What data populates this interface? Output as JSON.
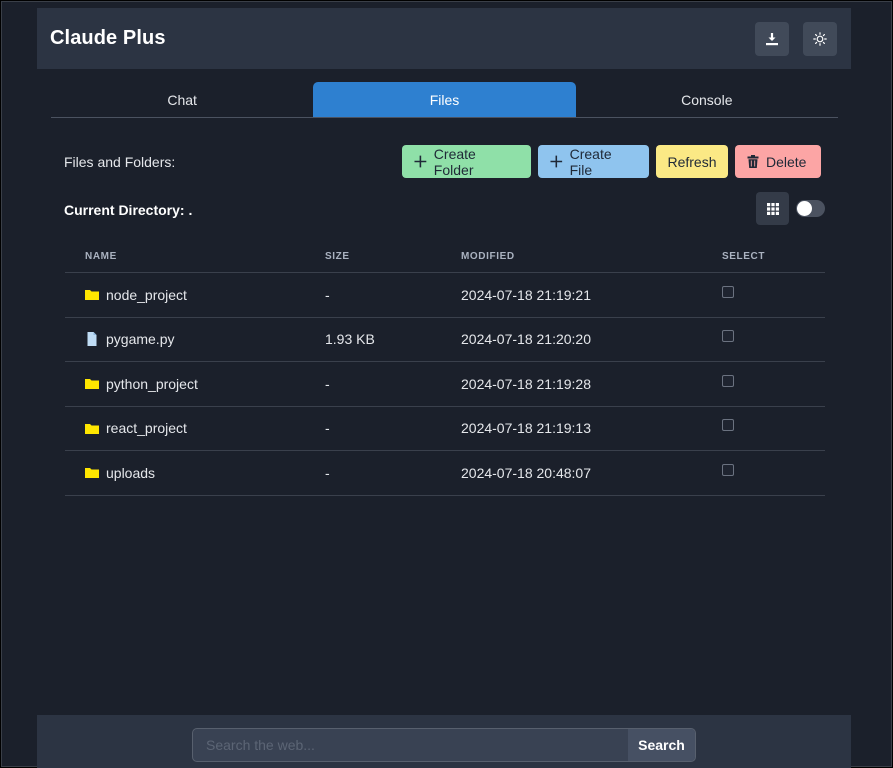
{
  "header": {
    "title": "Claude Plus",
    "download_icon": "download-icon",
    "theme_icon": "sun-icon"
  },
  "tabs": [
    {
      "label": "Chat",
      "active": false
    },
    {
      "label": "Files",
      "active": true
    },
    {
      "label": "Console",
      "active": false
    }
  ],
  "files": {
    "section_label": "Files and Folders:",
    "buttons": {
      "create_folder": "Create Folder",
      "create_file": "Create File",
      "refresh": "Refresh",
      "delete": "Delete"
    },
    "current_directory": "Current Directory: .",
    "view_toggle_on": false,
    "columns": [
      "NAME",
      "SIZE",
      "MODIFIED",
      "SELECT"
    ],
    "rows": [
      {
        "icon": "folder-icon",
        "name": "node_project",
        "size": "-",
        "modified": "2024-07-18 21:19:21",
        "selected": false
      },
      {
        "icon": "file-icon",
        "name": "pygame.py",
        "size": "1.93 KB",
        "modified": "2024-07-18 21:20:20",
        "selected": false
      },
      {
        "icon": "folder-icon",
        "name": "python_project",
        "size": "-",
        "modified": "2024-07-18 21:19:28",
        "selected": false
      },
      {
        "icon": "folder-icon",
        "name": "react_project",
        "size": "-",
        "modified": "2024-07-18 21:19:13",
        "selected": false
      },
      {
        "icon": "folder-icon",
        "name": "uploads",
        "size": "-",
        "modified": "2024-07-18 20:48:07",
        "selected": false
      }
    ]
  },
  "search": {
    "placeholder": "Search the web...",
    "value": "",
    "button_label": "Search"
  },
  "colors": {
    "accent_tab": "#2e80d0",
    "create_folder": "#8fe0a8",
    "create_file": "#8fc4ee",
    "refresh": "#fbe985",
    "delete": "#fca5a5",
    "folder": "#ffe600",
    "file": "#bfdcf5"
  }
}
